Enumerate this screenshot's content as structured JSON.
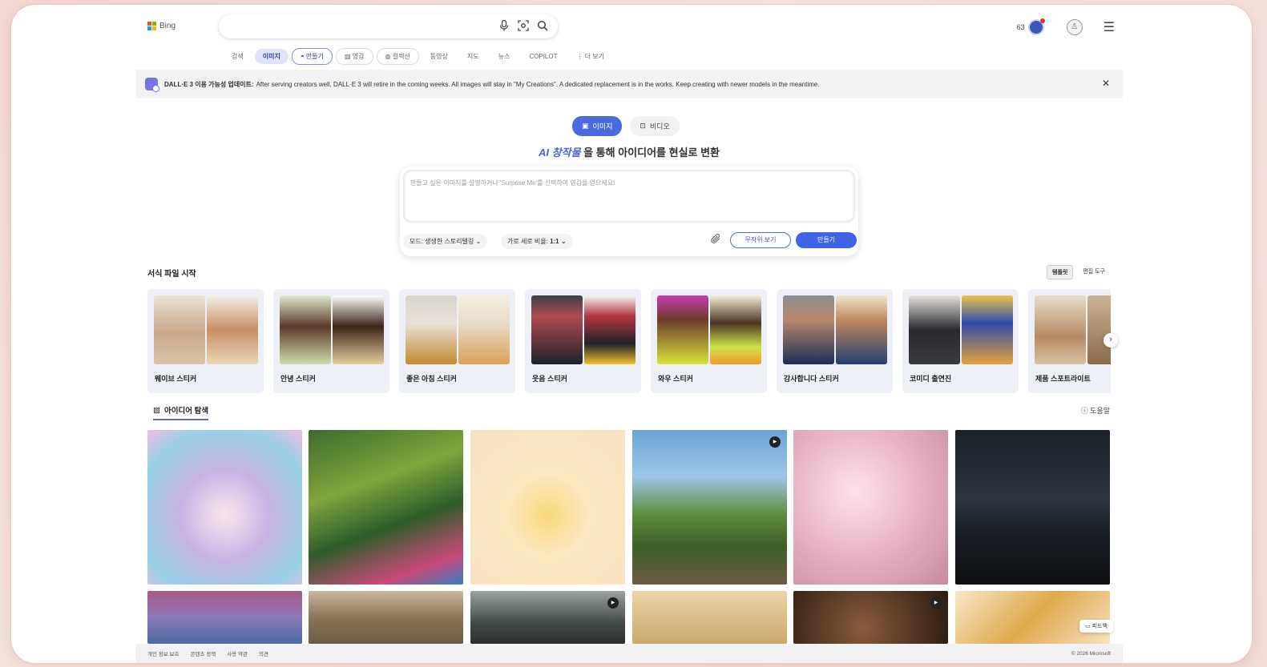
{
  "header": {
    "logo_text": "Bing",
    "logo_colors": [
      "#f25022",
      "#7fba00",
      "#00a4ef",
      "#ffb900"
    ],
    "search": {
      "value": "",
      "icons": [
        "microphone-icon",
        "visual-search-icon",
        "search-icon"
      ]
    },
    "points": "63",
    "nav": [
      {
        "label": "검색"
      },
      {
        "label": "이미지"
      },
      {
        "label": "만들기"
      },
      {
        "label": "영감"
      },
      {
        "label": "컬렉션"
      },
      {
        "label": "동영상"
      },
      {
        "label": "지도"
      },
      {
        "label": "뉴스"
      },
      {
        "label": "COPILOT"
      },
      {
        "label": "⋮ 더 보기"
      }
    ]
  },
  "banner": {
    "title": "DALL·E 3 이용 가능성 업데이트:",
    "message": "After serving creators well, DALL·E 3 will retire in the coming weeks. All images will stay in \"My Creations\". A dedicated replacement is in the works. Keep creating with newer models in the meantime.",
    "close": "✕"
  },
  "creator": {
    "tabs": [
      {
        "label": "이미지"
      },
      {
        "label": "비디오"
      }
    ],
    "tagline_ai": "AI 창작물",
    "tagline_rest": "을 통해 아이디어를 현실로 변환",
    "placeholder": "만들고 싶은 이미지를 설명하거나 'Surprise Me'를 선택하여 영감을 얻으세요!",
    "mode": "모드: 생생한 스토리텔링 ⌄",
    "ratio_label": "가로 세로 비율:",
    "ratio_value": "1:1 ⌄",
    "surprise_label": "무작위 보기",
    "create_label": "만들기"
  },
  "templates": {
    "title": "서식 파일 시작",
    "tools": [
      {
        "label": "템플릿"
      },
      {
        "label": "편집 도구"
      }
    ],
    "items": [
      {
        "label": "웨이브 스티커"
      },
      {
        "label": "안녕 스티커"
      },
      {
        "label": "좋은 아침 스티커"
      },
      {
        "label": "웃음 스티커"
      },
      {
        "label": "와우 스티커"
      },
      {
        "label": "감사합니다 스티커"
      },
      {
        "label": "코미디 출연진"
      },
      {
        "label": "제품 스포트라이트"
      }
    ]
  },
  "explore": {
    "tab_label": "아이디어 탐색",
    "help_label": "도움말",
    "feedback_label": "피드백"
  },
  "footer": {
    "links": [
      {
        "label": "개인 정보 보호"
      },
      {
        "label": "콘텐츠 정책"
      },
      {
        "label": "사용 약관"
      },
      {
        "label": "의견"
      }
    ],
    "copyright": "© 2026 Microsoft"
  }
}
